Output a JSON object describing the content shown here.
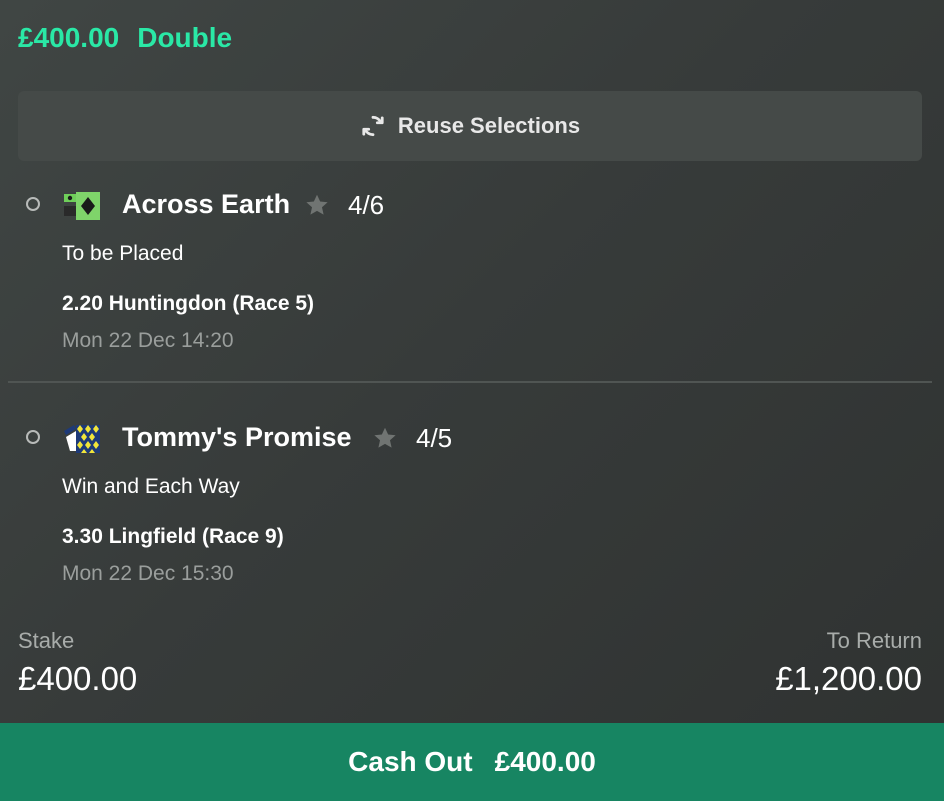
{
  "header": {
    "amount": "£400.00",
    "bet_type": "Double"
  },
  "reuse_button": {
    "label": "Reuse Selections",
    "icon": "refresh-icon"
  },
  "selections": [
    {
      "runner": "Across Earth",
      "odds": "4/6",
      "market": "To be Placed",
      "race": "2.20 Huntingdon (Race 5)",
      "datetime": "Mon 22 Dec 14:20",
      "silk_icon": "jockey-silk-green-diamond-icon"
    },
    {
      "runner": "Tommy's Promise",
      "odds": "4/5",
      "market": "Win and Each Way",
      "race": "3.30 Lingfield (Race 9)",
      "datetime": "Mon 22 Dec 15:30",
      "silk_icon": "jockey-silk-yellow-diamonds-icon"
    }
  ],
  "summary": {
    "stake_label": "Stake",
    "stake_value": "£400.00",
    "return_label": "To Return",
    "return_value": "£1,200.00"
  },
  "cashout": {
    "label": "Cash Out",
    "amount": "£400.00"
  },
  "colors": {
    "accent": "#2ae8a6",
    "cashout_bg": "#178562",
    "button_bg": "#454a48",
    "muted_text": "#9a9e9c"
  }
}
